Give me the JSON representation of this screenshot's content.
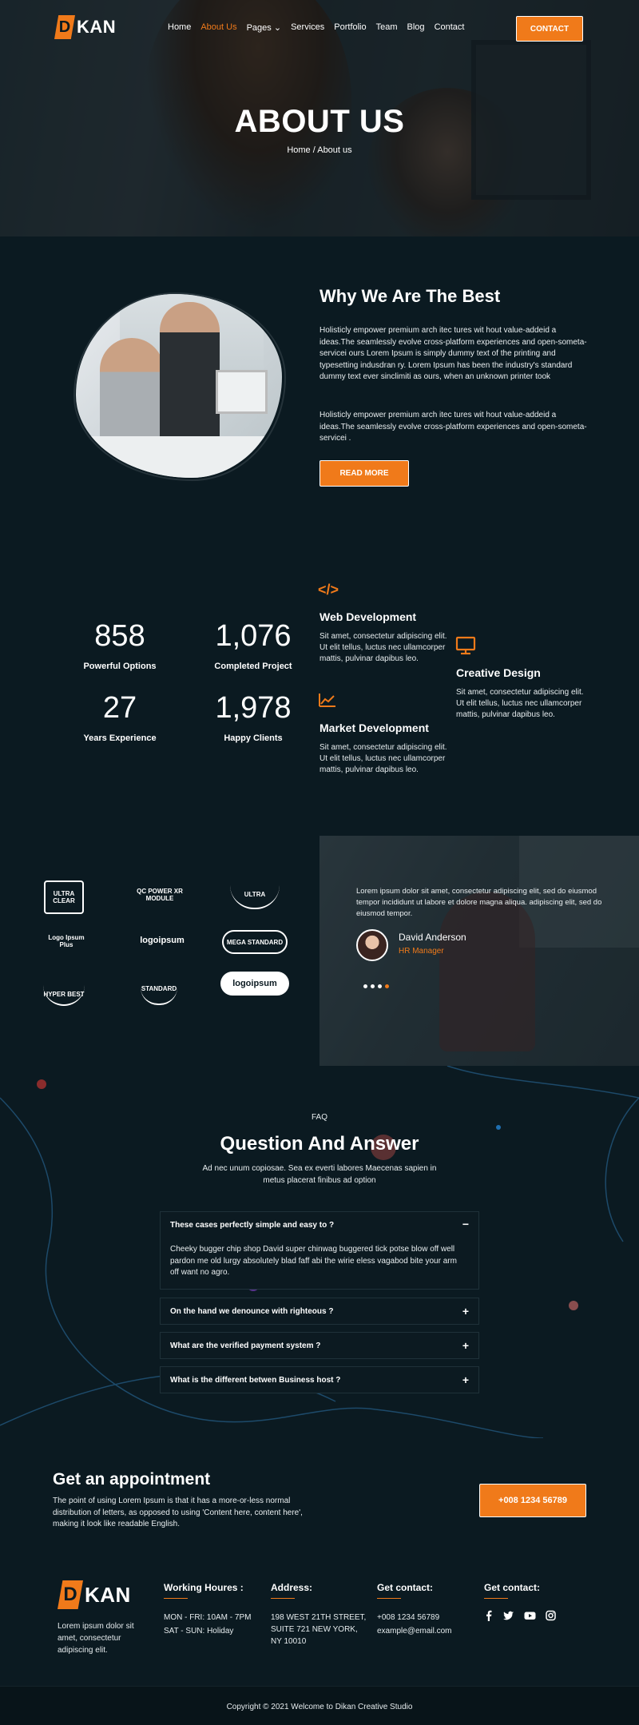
{
  "header": {
    "logo_mark": "D",
    "logo_text": "KAN",
    "nav": [
      "Home",
      "About Us",
      "Pages",
      "Services",
      "Portfolio",
      "Team",
      "Blog",
      "Contact"
    ],
    "pages_caret": "⌄",
    "contact_button": "CONTACT"
  },
  "hero": {
    "title": "ABOUT US",
    "breadcrumb": "Home / About us"
  },
  "why": {
    "title": "Why We Are The Best",
    "para1": "Holisticly empower premium arch itec tures wit hout value-addeid a ideas.The seamlessly evolve cross-platform experiences and open-someta-servicei ours Lorem Ipsum is simply dummy text of the printing and typesetting indusdran ry. Lorem Ipsum has been the industry's standard dummy text ever sinclimiti as ours, when an unknown printer took",
    "para2": "Holisticly empower premium arch itec tures wit hout value-addeid a ideas.The seamlessly evolve cross-platform experiences and open-someta-servicei .",
    "button": "READ MORE"
  },
  "stats": [
    {
      "value": "858",
      "label": "Powerful Options"
    },
    {
      "value": "1,076",
      "label": "Completed Project"
    },
    {
      "value": "27",
      "label": "Years Experience"
    },
    {
      "value": "1,978",
      "label": "Happy Clients"
    }
  ],
  "services": [
    {
      "icon": "code-icon",
      "glyph": "</>",
      "title": "Web Development",
      "text": "Sit amet, consectetur adipiscing elit. Ut elit tellus, luctus nec ullamcorper mattis, pulvinar dapibus leo."
    },
    {
      "icon": "chart-icon",
      "glyph": "📈",
      "title": "Market Development",
      "text": "Sit amet, consectetur adipiscing elit. Ut elit tellus, luctus nec ullamcorper mattis, pulvinar dapibus leo."
    },
    {
      "icon": "monitor-icon",
      "glyph": "🖵",
      "title": "Creative Design",
      "text": "Sit amet, consectetur adipiscing elit. Ut elit tellus, luctus nec ullamcorper mattis, pulvinar dapibus leo."
    }
  ],
  "brands": [
    "ULTRA CLEAR",
    "QC POWER XR MODULE",
    "ULTRA",
    "Logo Ipsum Plus",
    "logoipsum",
    "MEGA STANDARD",
    "HYPER BEST",
    "STANDARD",
    "logoipsum"
  ],
  "testimonial": {
    "quote": "Lorem ipsum dolor sit amet, consectetur adipiscing elit, sed do eiusmod tempor incididunt ut labore et dolore magna aliqua. adipiscing elit, sed do eiusmod tempor.",
    "name": "David Anderson",
    "role": "HR Manager",
    "slides": 4,
    "active_slide": 4
  },
  "faq": {
    "kicker": "FAQ",
    "title": "Question And Answer",
    "subtitle": "Ad nec unum copiosae. Sea ex everti labores Maecenas sapien in metus placerat finibus ad option",
    "items": [
      {
        "q": "These cases perfectly simple and easy to ?",
        "a": "Cheeky bugger chip shop David super chinwag buggered tick potse blow off well pardon me old lurgy absolutely blad faff abi the wirie eless vagabod bite your arm off want no agro.",
        "open": true,
        "sign": "−"
      },
      {
        "q": "On the hand we denounce with righteous ?",
        "open": false,
        "sign": "+"
      },
      {
        "q": "What are the verified payment system ?",
        "open": false,
        "sign": "+"
      },
      {
        "q": "What is the different betwen Business host ?",
        "open": false,
        "sign": "+"
      }
    ]
  },
  "appointment": {
    "title": "Get an appointment",
    "text": "The point of using Lorem Ipsum is that it has a more-or-less normal distribution of letters, as opposed to using 'Content here, content here', making it look like readable English.",
    "phone_button": "+008 1234 56789"
  },
  "footer": {
    "about": "Lorem ipsum dolor sit amet, consectetur adipiscing elit.",
    "cols": [
      {
        "title": "Working Houres :",
        "lines": [
          "MON - FRI: 10AM - 7PM",
          "SAT - SUN: Holiday"
        ]
      },
      {
        "title": "Address:",
        "lines": [
          "198 WEST 21TH STREET, SUITE 721 NEW YORK, NY 10010"
        ]
      },
      {
        "title": "Get contact:",
        "lines": [
          "+008 1234 56789",
          "example@email.com"
        ]
      },
      {
        "title": "Get contact:",
        "social": [
          "facebook-icon",
          "twitter-icon",
          "youtube-icon",
          "instagram-icon"
        ]
      }
    ],
    "copyright": "Copyright © 2021 Welcome to Dikan Creative Studio"
  },
  "colors": {
    "accent": "#f07a1a",
    "background": "#0b1a21"
  }
}
